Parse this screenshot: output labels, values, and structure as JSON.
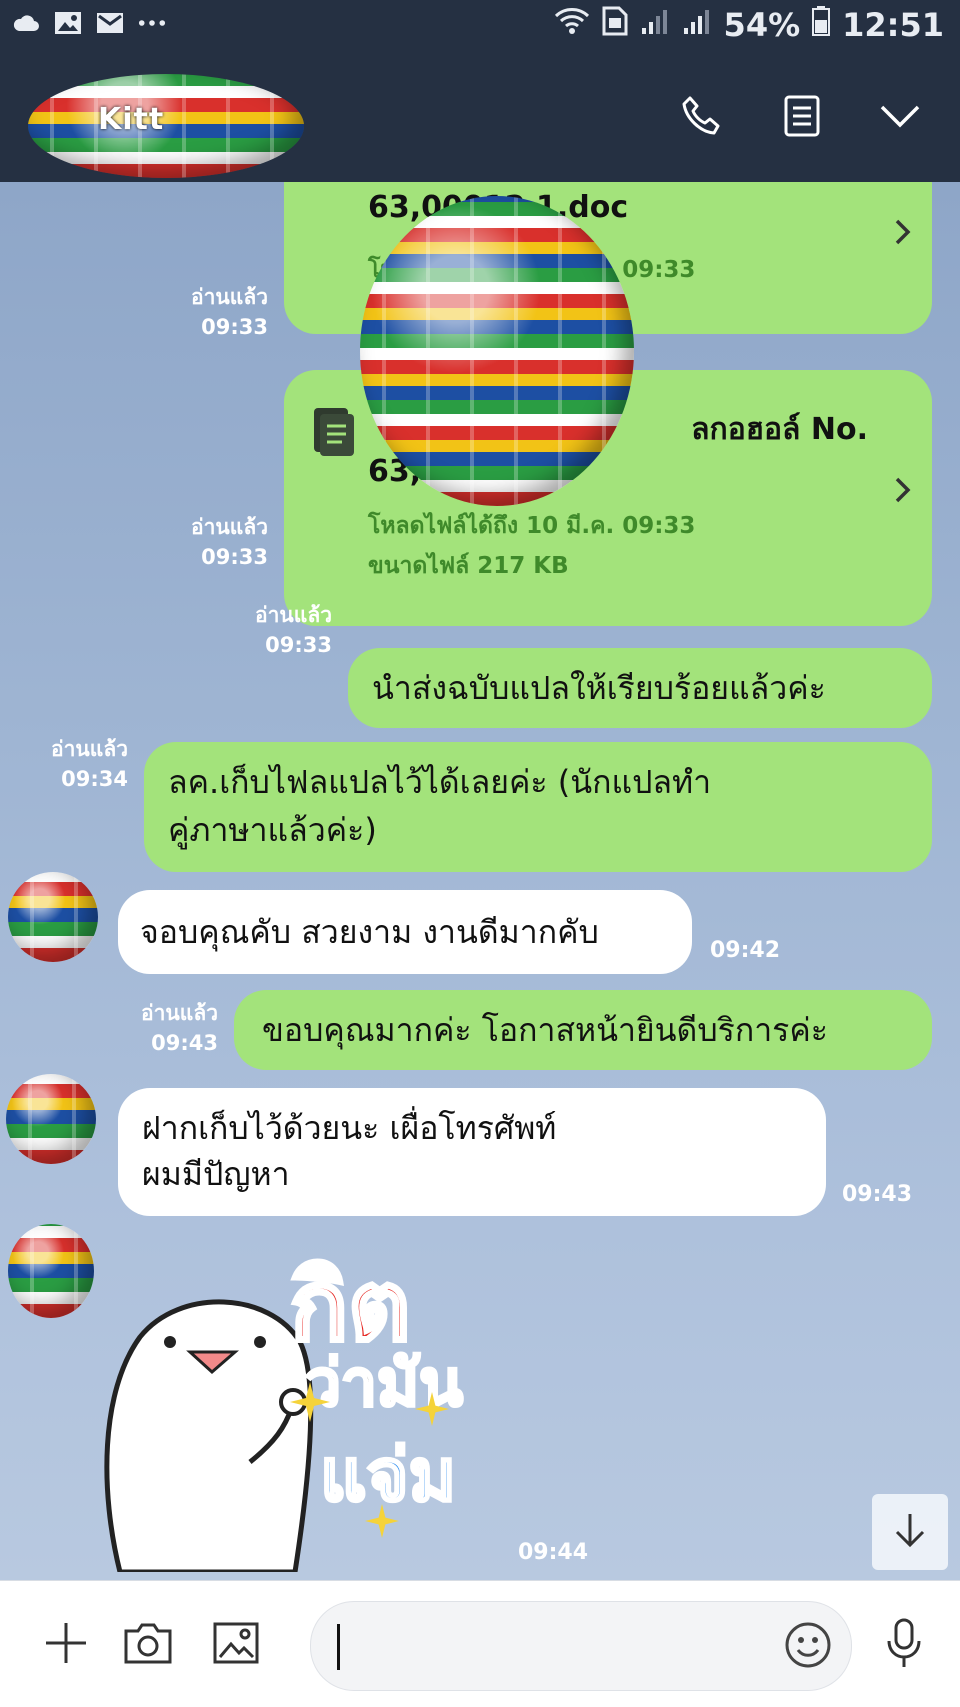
{
  "status": {
    "battery_pct": "54%",
    "time": "12:51"
  },
  "header": {
    "title": "Kitt",
    "call_label": "call",
    "notes_label": "notes",
    "menu_label": "menu"
  },
  "messages": {
    "file1": {
      "name": "63,00012 1.doc",
      "download": "โหลดไฟล์ได้ถึง 10 มี.ค. 09:33",
      "read": "อ่านแล้ว",
      "time": "09:33"
    },
    "file2": {
      "name_line1": "ลกอฮอล์ No.",
      "name_line2": "63,000 .pdf",
      "download": "โหลดไฟล์ได้ถึง 10 มี.ค. 09:33",
      "size": "ขนาดไฟล์ 217 KB",
      "read": "อ่านแล้ว",
      "time": "09:33"
    },
    "out1": {
      "text": "นำส่งฉบับแปลให้เรียบร้อยแล้วค่ะ",
      "read": "อ่านแล้ว",
      "time": "09:33"
    },
    "out2": {
      "line1": "ลค.เก็บไฟลแปลไว้ได้เลยค่ะ (นักแปลทำ",
      "line2": "คู่ภาษาแล้วค่ะ)",
      "read": "อ่านแล้ว",
      "time": "09:34"
    },
    "in1": {
      "text": "จอบคุณคับ สวยงาม งานดีมากคับ",
      "time": "09:42"
    },
    "out3": {
      "text": "ขอบคุณมากค่ะ โอกาสหน้ายินดีบริการค่ะ",
      "read": "อ่านแล้ว",
      "time": "09:43"
    },
    "in2": {
      "line1": "ฝากเก็บไว้ด้วยนะ เผื่อโทรศัพท์",
      "line2": "ผมมีปัญหา",
      "time": "09:43"
    },
    "sticker": {
      "word1": "กิต",
      "word2": "ว่ามัน",
      "word3": "แจ่ม",
      "time": "09:44"
    }
  },
  "input": {
    "placeholder": ""
  },
  "colors": {
    "header_bg": "#253042",
    "bubble_out": "#a3e37b",
    "bubble_in": "#ffffff"
  }
}
